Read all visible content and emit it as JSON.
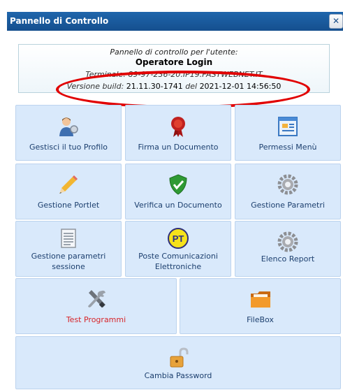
{
  "window": {
    "title": "Pannello di Controllo",
    "close_symbol": "✕"
  },
  "info": {
    "line1": "Pannello di controllo per l'utente:",
    "user": "Operatore Login",
    "terminal": "Terminale: 89-97-236-20.IP19.FASTWEBNET.IT",
    "build_label": "Versione build:",
    "build_value": "21.11.30-1741",
    "date_label": "del",
    "date_value": "2021-12-01 14:56:50"
  },
  "tiles": [
    {
      "label": "Gestisci il tuo Profilo",
      "icon": "user-profile-icon"
    },
    {
      "label": "Firma un Documento",
      "icon": "seal-icon"
    },
    {
      "label": "Permessi Menù",
      "icon": "menu-window-icon"
    },
    {
      "label": "Gestione Portlet",
      "icon": "pencil-icon"
    },
    {
      "label": "Verifica un Documento",
      "icon": "shield-check-icon"
    },
    {
      "label": "Gestione Parametri",
      "icon": "gear-icon"
    },
    {
      "label_line1": "Gestione parametri",
      "label_line2": "sessione",
      "icon": "document-icon"
    },
    {
      "label_line1": "Poste Comunicazioni",
      "label_line2": "Elettroniche",
      "icon": "pt-icon",
      "icon_text": "PT"
    },
    {
      "label": "Elenco Report",
      "icon": "gear-icon"
    },
    {
      "label": "Test Programmi",
      "icon": "tools-icon",
      "label_color": "#d8252a"
    },
    {
      "label": "FileBox",
      "icon": "folder-icon"
    },
    {
      "label": "Cambia Password",
      "icon": "padlock-icon"
    }
  ],
  "colors": {
    "title_bar": "#1a5a9e",
    "tile_bg": "#d9e9fb",
    "highlight": "#e10000"
  }
}
